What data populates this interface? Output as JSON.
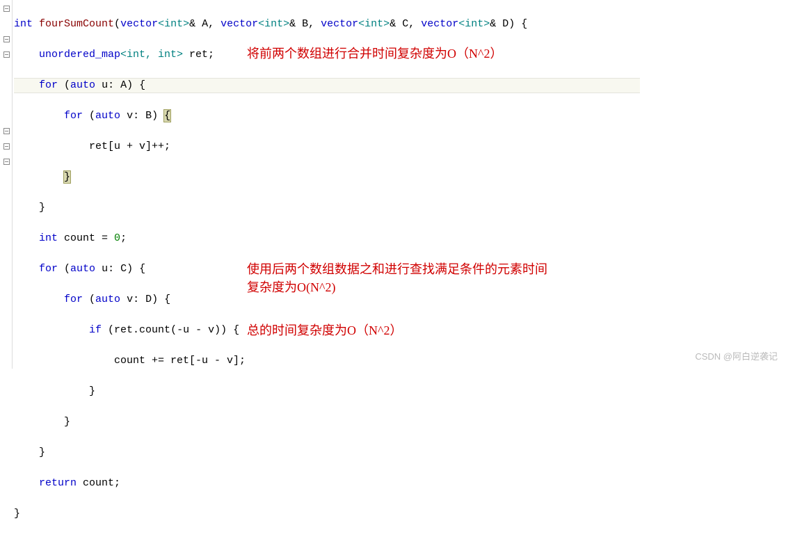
{
  "code": {
    "l1a": "int ",
    "l1b": "fourSumCount",
    "l1c": "(",
    "l1d": "vector",
    "l1e": "<int>",
    "l1f": "& A, ",
    "l1g": "vector",
    "l1h": "<int>",
    "l1i": "& B, ",
    "l1j": "vector",
    "l1k": "<int>",
    "l1l": "& C, ",
    "l1m": "vector",
    "l1n": "<int>",
    "l1o": "& D) {",
    "l2a": "    unordered_map",
    "l2b": "<int, int>",
    "l2c": " ret;",
    "l3a": "    ",
    "l3b": "for",
    "l3c": " (",
    "l3d": "auto",
    "l3e": " u: A) {",
    "l4a": "        ",
    "l4b": "for",
    "l4c": " (",
    "l4d": "auto",
    "l4e": " v: B) ",
    "l4f": "{",
    "l5a": "            ret[u + v]++;",
    "l6a": "        ",
    "l6b": "}",
    "l7a": "    }",
    "l8a": "    ",
    "l8b": "int",
    "l8c": " count = ",
    "l8d": "0",
    "l8e": ";",
    "l9a": "    ",
    "l9b": "for",
    "l9c": " (",
    "l9d": "auto",
    "l9e": " u: C) {",
    "l10a": "        ",
    "l10b": "for",
    "l10c": " (",
    "l10d": "auto",
    "l10e": " v: D) {",
    "l11a": "            ",
    "l11b": "if",
    "l11c": " (ret.count(-u - v)) {",
    "l12a": "                count += ret[-u - v];",
    "l13a": "            }",
    "l14a": "        }",
    "l15a": "    }",
    "l16a": "    ",
    "l16b": "return",
    "l16c": " count;",
    "l17a": "}"
  },
  "annotations": {
    "a1": "将前两个数组进行合并时间复杂度为O（N^2）",
    "a2": "使用后两个数组数据之和进行查找满足条件的元素时间复杂度为O(N^2)",
    "a3": "总的时间复杂度为O（N^2）"
  },
  "watermark": "CSDN @阿白逆袭记",
  "chart_data": {
    "type": "table",
    "description": "C++ fourSumCount implementation with complexity annotations",
    "code_lines": [
      "int fourSumCount(vector<int>& A, vector<int>& B, vector<int>& C, vector<int>& D) {",
      "    unordered_map<int, int> ret;",
      "    for (auto u: A) {",
      "        for (auto v: B) {",
      "            ret[u + v]++;",
      "        }",
      "    }",
      "    int count = 0;",
      "    for (auto u: C) {",
      "        for (auto v: D) {",
      "            if (ret.count(-u - v)) {",
      "                count += ret[-u - v];",
      "            }",
      "        }",
      "    }",
      "    return count;",
      "}"
    ],
    "annotations": [
      {
        "text": "将前两个数组进行合并时间复杂度为O（N^2）",
        "refers_to_lines": [
          3,
          4,
          5,
          6,
          7
        ]
      },
      {
        "text": "使用后两个数组数据之和进行查找满足条件的元素时间复杂度为O(N^2)",
        "refers_to_lines": [
          9,
          10,
          11,
          12,
          13,
          14,
          15
        ]
      },
      {
        "text": "总的时间复杂度为O（N^2）",
        "refers_to_lines": [
          1,
          17
        ]
      }
    ]
  }
}
